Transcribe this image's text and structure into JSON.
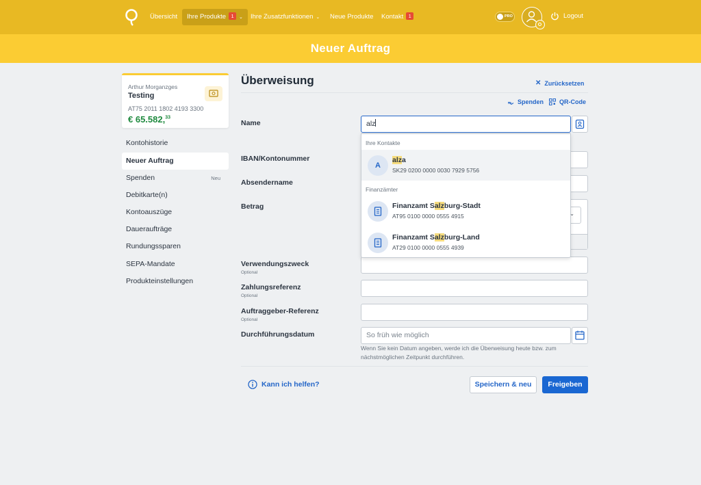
{
  "nav": {
    "items": [
      {
        "label": "Übersicht"
      },
      {
        "label": "Ihre Produkte",
        "badge": "1"
      },
      {
        "label": "Ihre Zusatzfunktionen"
      },
      {
        "label": "Neue Produkte"
      },
      {
        "label": "Kontakt",
        "badge": "1"
      }
    ],
    "toggle_label": "PRO",
    "logout_label": "Logout"
  },
  "banner": {
    "title": "Neuer Auftrag"
  },
  "account": {
    "owner": "Arthur Morganzges",
    "name": "Testing",
    "iban": "AT75 2011 1802 4193 3300",
    "balance_main": "€ 65.582,",
    "balance_cents": "33"
  },
  "sidebar": {
    "items": [
      {
        "label": "Kontohistorie"
      },
      {
        "label": "Neuer Auftrag"
      },
      {
        "label": "Spenden",
        "badge": "Neu"
      },
      {
        "label": "Debitkarte(n)"
      },
      {
        "label": "Kontoauszüge"
      },
      {
        "label": "Daueraufträge"
      },
      {
        "label": "Rundungssparen"
      },
      {
        "label": "SEPA-Mandate"
      },
      {
        "label": "Produkteinstellungen"
      }
    ]
  },
  "form": {
    "title": "Überweisung",
    "reset_label": "Zurücksetzen",
    "donate_label": "Spenden",
    "qr_label": "QR-Code",
    "name_label": "Name",
    "name_value": "alz",
    "iban_label": "IBAN/Kontonummer",
    "sender_label": "Absendername",
    "amount_label": "Betrag",
    "purpose_label": "Verwendungszweck",
    "payment_ref_label": "Zahlungsreferenz",
    "client_ref_label": "Auftraggeber-Referenz",
    "optional": "Optional",
    "date_label": "Durchführungsdatum",
    "date_placeholder": "So früh wie möglich",
    "date_hint": "Wenn Sie kein Datum angeben, werde ich die Überweisung heute bzw. zum nächstmöglichen Zeitpunkt durchführen.",
    "help_label": "Kann ich helfen?",
    "save_new_label": "Speichern & neu",
    "submit_label": "Freigeben"
  },
  "dropdown": {
    "contacts_heading": "Ihre Kontakte",
    "contacts": [
      {
        "initial": "A",
        "name_pre": "",
        "name_match": "alz",
        "name_post": "a",
        "iban": "SK29 0200 0000 0030 7929 5756"
      }
    ],
    "tax_heading": "Finanzämter",
    "tax_offices": [
      {
        "name_pre": "Finanzamt S",
        "name_match": "alz",
        "name_post": "burg-Stadt",
        "iban": "AT95 0100 0000 0555 4915"
      },
      {
        "name_pre": "Finanzamt S",
        "name_match": "alz",
        "name_post": "burg-Land",
        "iban": "AT29 0100 0000 0555 4939"
      }
    ]
  },
  "colors": {
    "brand_yellow": "#fbcc33",
    "nav_yellow": "#e8b923",
    "primary_blue": "#1a67d2",
    "balance_green": "#1f8a3f"
  }
}
